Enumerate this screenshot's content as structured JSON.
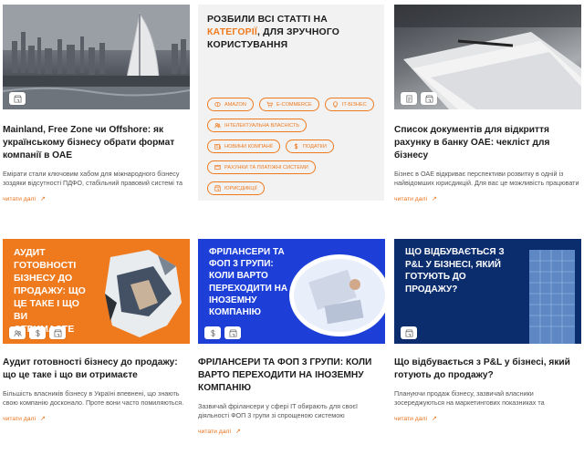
{
  "categories": {
    "title_part1": "Розбили всі статті на ",
    "title_highlight": "категорії",
    "title_part2": ", для зручного користування",
    "chips": [
      {
        "label": "AMAZON",
        "icon": "coin-icon"
      },
      {
        "label": "E-COMMERCE",
        "icon": "cart-icon"
      },
      {
        "label": "IT-БІЗНЕС",
        "icon": "bulb-icon"
      },
      {
        "label": "ІНТЕЛЕКТУАЛЬНА ВЛАСНІСТЬ",
        "icon": "users-icon"
      },
      {
        "label": "НОВИНИ КОМПАНІЇ",
        "icon": "news-icon"
      },
      {
        "label": "ПОДАТКИ",
        "icon": "dollar-icon"
      },
      {
        "label": "РАХУНКИ ТА ПЛАТІЖНІ СИСТЕМИ",
        "icon": "card-icon"
      },
      {
        "label": "ЮРИСДИКЦІЇ",
        "icon": "building-icon"
      }
    ],
    "accent": "#ef7a1e"
  },
  "articles": [
    {
      "title": "Mainland, Free Zone чи Offshore: як українському бізнесу обрати формат компанії в ОАЕ",
      "excerpt": "Емірати стали ключовим хабом для міжнародного бізнесу зоздяки відсутності ПДФО, стабільний правовий системі та",
      "more": "читати далі",
      "tags": [
        "building-icon"
      ]
    },
    {
      "title": "Список документів для відкриття рахунку в банку ОАЕ: чекліст для бізнесу",
      "excerpt": "Бізнес в ОАЕ відкриває перспективи розвитку в одній із найвідомших юрисдикцій. Для вас це можливість працювати",
      "more": "читати далі",
      "tags": [
        "news-icon",
        "building-icon"
      ]
    },
    {
      "thumb_text": "Аудит готовності бізнесу до продажу: що це таке і що ви отримаєте",
      "title": "Аудит готовності бізнесу до продажу: що це таке і що ви отримаєте",
      "excerpt": "Більшість власників бізнесу в Україні впевнені, що знають свою компанію досконало. Проте вони часто помиляються.",
      "more": "читати далі",
      "tags": [
        "users-icon",
        "dollar-icon",
        "building-icon"
      ]
    },
    {
      "thumb_text": "Фрілансери та ФОП 3 групи: коли варто переходити на іноземну компанію",
      "title": "ФРІЛАНСЕРИ ТА ФОП 3 ГРУПИ: КОЛИ ВАРТО ПЕРЕХОДИТИ НА ІНОЗЕМНУ КОМПАНІЮ",
      "excerpt": "Зазвичай фрілансери у сфері IT обирають для своєї діяльності ФОП 3 групи зі спрощеною системою",
      "more": "читати далі",
      "tags": [
        "dollar-icon",
        "building-icon"
      ]
    },
    {
      "thumb_text": "Що відбувається з P&L у бізнесі, який готують до продажу?",
      "title": "Що відбувається з P&L у бізнесі, який готують до продажу?",
      "excerpt": "Плануючи продаж бізнесу, зазвичай власники зосереджуються на маркетингових показниках та",
      "more": "читати далі",
      "tags": [
        "building-icon"
      ]
    }
  ]
}
